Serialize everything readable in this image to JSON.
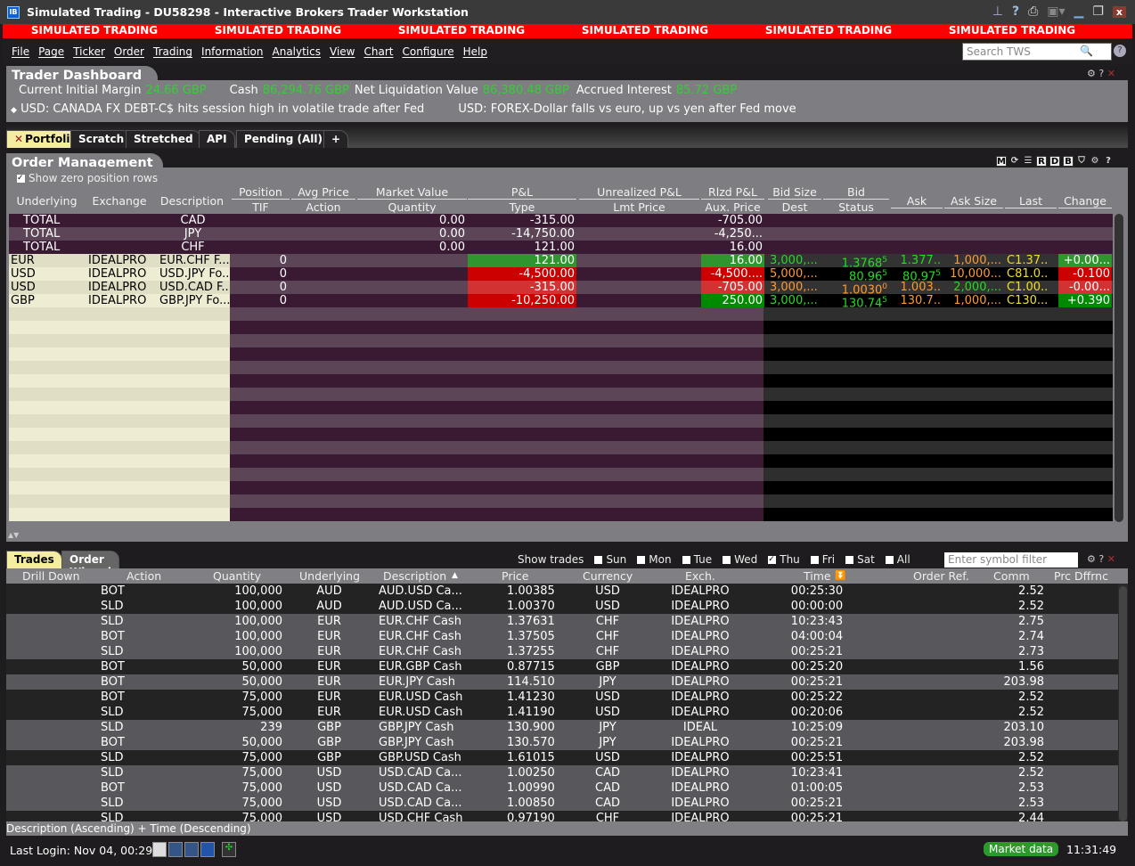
{
  "window": {
    "title": "Simulated Trading - DU58298 - Interactive Brokers Trader Workstation",
    "logo": "IB"
  },
  "banner": [
    "SIMULATED TRADING",
    "SIMULATED TRADING",
    "SIMULATED TRADING",
    "SIMULATED TRADING",
    "SIMULATED TRADING",
    "SIMULATED TRADING"
  ],
  "menu": [
    "File",
    "Page",
    "Ticker",
    "Order",
    "Trading",
    "Information",
    "Analytics",
    "View",
    "Chart",
    "Configure",
    "Help"
  ],
  "search": {
    "placeholder": "Search TWS"
  },
  "dashboard": {
    "title": "Trader Dashboard",
    "metrics": [
      {
        "label": "Current Initial Margin",
        "value": "24.66 GBP"
      },
      {
        "label": "Cash",
        "value": "86,294.76 GBP"
      },
      {
        "label": "Net Liquidation Value",
        "value": "86,380.48 GBP"
      },
      {
        "label": "Accrued Interest",
        "value": "85.72 GBP"
      }
    ],
    "news": [
      "USD: CANADA FX DEBT-C$ hits session high in volatile trade after Fed",
      "USD: FOREX-Dollar falls vs euro, up vs yen after Fed move"
    ]
  },
  "tabs": [
    "Portfolio",
    "Scratch",
    "Stretched",
    "API",
    "Pending (All)",
    "+"
  ],
  "order_mgmt": {
    "title": "Order Management",
    "show_zero": "Show zero position rows",
    "toolbar": [
      "M",
      "R",
      "D",
      "B"
    ],
    "headers_top": [
      "Underlying",
      "Exchange",
      "Description",
      "Position",
      "Avg Price",
      "Market Value",
      "P&L",
      "Unrealized P&L",
      "Rlzd P&L",
      "Bid Size",
      "Bid",
      "Ask",
      "Ask Size",
      "Last",
      "Change"
    ],
    "headers_bottom": [
      "TIF",
      "Action",
      "Quantity",
      "Type",
      "Lmt Price",
      "Aux. Price",
      "Dest",
      "Status"
    ],
    "totals": [
      {
        "label": "TOTAL",
        "currency": "CAD",
        "market_value": "0.00",
        "pnl": "-315.00",
        "rlzd": "-705.00"
      },
      {
        "label": "TOTAL",
        "currency": "JPY",
        "market_value": "0.00",
        "pnl": "-14,750.00",
        "rlzd": "-4,250..."
      },
      {
        "label": "TOTAL",
        "currency": "CHF",
        "market_value": "0.00",
        "pnl": "121.00",
        "rlzd": "16.00"
      }
    ],
    "positions": [
      {
        "underlying": "EUR",
        "exchange": "IDEALPRO",
        "description": "EUR.CHF F...",
        "position": "0",
        "pnl": "121.00",
        "pnl_bg": "#2f962f",
        "rlzd": "16.00",
        "rlzd_bg": "#2f962f",
        "bid_size": "3,000,...",
        "bid_size_c": "#22dd22",
        "bid": "1.3768",
        "bid_sup": "5",
        "bid_c": "#22dd22",
        "ask": "1.377..",
        "ask_c": "#22dd22",
        "ask_size": "1,000,...",
        "ask_size_c": "#ff9933",
        "last": "C1.37..",
        "change": "+0.00...",
        "change_bg": "#2f962f"
      },
      {
        "underlying": "USD",
        "exchange": "IDEALPRO",
        "description": "USD.JPY Fo...",
        "position": "0",
        "pnl": "-4,500.00",
        "pnl_bg": "#cc0000",
        "rlzd": "-4,500....",
        "rlzd_bg": "#cc0000",
        "bid_size": "5,000,...",
        "bid_size_c": "#ff9933",
        "bid": "80.96",
        "bid_sup": "5",
        "bid_c": "#22dd22",
        "ask": "80.97",
        "ask_sup": "5",
        "ask_c": "#22dd22",
        "ask_size": "10,000...",
        "ask_size_c": "#ff9933",
        "last": "C81.0..",
        "change": "-0.100",
        "change_bg": "#cc0000"
      },
      {
        "underlying": "USD",
        "exchange": "IDEALPRO",
        "description": "USD.CAD F...",
        "position": "0",
        "pnl": "-315.00",
        "pnl_bg": "#d23232",
        "rlzd": "-705.00",
        "rlzd_bg": "#d23232",
        "bid_size": "3,000,...",
        "bid_size_c": "#ff9933",
        "bid": "1.0030",
        "bid_sup": "0",
        "bid_c": "#ff9933",
        "ask": "1.003..",
        "ask_c": "#ff9933",
        "ask_size": "2,000,...",
        "ask_size_c": "#22dd22",
        "last": "C1.00..",
        "change": "-0.00...",
        "change_bg": "#d23232"
      },
      {
        "underlying": "GBP",
        "exchange": "IDEALPRO",
        "description": "GBP.JPY Fo...",
        "position": "0",
        "pnl": "-10,250.00",
        "pnl_bg": "#cc0000",
        "rlzd": "250.00",
        "rlzd_bg": "#008a00",
        "bid_size": "3,000,...",
        "bid_size_c": "#22dd22",
        "bid": "130.74",
        "bid_sup": "5",
        "bid_c": "#22dd22",
        "ask": "130.7..",
        "ask_c": "#ff9933",
        "ask_size": "1,000,...",
        "ask_size_c": "#ff9933",
        "last": "C130...",
        "change": "+0.390",
        "change_bg": "#008a00"
      }
    ]
  },
  "trades": {
    "tabs": [
      "Trades",
      "Order Wizard"
    ],
    "show_trades": "Show trades",
    "days": [
      {
        "d": "Sun",
        "on": false
      },
      {
        "d": "Mon",
        "on": false
      },
      {
        "d": "Tue",
        "on": false
      },
      {
        "d": "Wed",
        "on": false
      },
      {
        "d": "Thu",
        "on": true
      },
      {
        "d": "Fri",
        "on": false
      },
      {
        "d": "Sat",
        "on": false
      },
      {
        "d": "All",
        "on": false
      }
    ],
    "filter_placeholder": "Enter symbol filter",
    "headers": [
      "Drill Down",
      "Action",
      "Quantity",
      "Underlying",
      "Description",
      "Price",
      "Currency",
      "Exch.",
      "Time",
      "Order Ref.",
      "Comm",
      "Prc Dffrnc"
    ],
    "rows": [
      [
        "BOT",
        "100,000",
        "AUD",
        "AUD.USD Ca...",
        "1.00385",
        "USD",
        "IDEALPRO",
        "00:25:30",
        "2.52"
      ],
      [
        "SLD",
        "100,000",
        "AUD",
        "AUD.USD Ca...",
        "1.00370",
        "USD",
        "IDEALPRO",
        "00:00:00",
        "2.52"
      ],
      [
        "SLD",
        "100,000",
        "EUR",
        "EUR.CHF Cash",
        "1.37631",
        "CHF",
        "IDEALPRO",
        "10:23:43",
        "2.75"
      ],
      [
        "BOT",
        "100,000",
        "EUR",
        "EUR.CHF Cash",
        "1.37505",
        "CHF",
        "IDEALPRO",
        "04:00:04",
        "2.74"
      ],
      [
        "SLD",
        "100,000",
        "EUR",
        "EUR.CHF Cash",
        "1.37255",
        "CHF",
        "IDEALPRO",
        "00:25:21",
        "2.73"
      ],
      [
        "BOT",
        "50,000",
        "EUR",
        "EUR.GBP Cash",
        "0.87715",
        "GBP",
        "IDEALPRO",
        "00:25:20",
        "1.56"
      ],
      [
        "BOT",
        "50,000",
        "EUR",
        "EUR.JPY Cash",
        "114.510",
        "JPY",
        "IDEALPRO",
        "00:25:21",
        "203.98"
      ],
      [
        "BOT",
        "75,000",
        "EUR",
        "EUR.USD Cash",
        "1.41230",
        "USD",
        "IDEALPRO",
        "00:25:22",
        "2.52"
      ],
      [
        "SLD",
        "75,000",
        "EUR",
        "EUR.USD Cash",
        "1.41190",
        "USD",
        "IDEALPRO",
        "00:20:06",
        "2.52"
      ],
      [
        "SLD",
        "239",
        "GBP",
        "GBP.JPY Cash",
        "130.900",
        "JPY",
        "IDEAL",
        "10:25:09",
        "203.10"
      ],
      [
        "BOT",
        "50,000",
        "GBP",
        "GBP.JPY Cash",
        "130.570",
        "JPY",
        "IDEALPRO",
        "00:25:21",
        "203.98"
      ],
      [
        "SLD",
        "75,000",
        "GBP",
        "GBP.USD Cash",
        "1.61015",
        "USD",
        "IDEALPRO",
        "00:25:51",
        "2.52"
      ],
      [
        "SLD",
        "75,000",
        "USD",
        "USD.CAD Ca...",
        "1.00250",
        "CAD",
        "IDEALPRO",
        "10:23:41",
        "2.52"
      ],
      [
        "BOT",
        "75,000",
        "USD",
        "USD.CAD Ca...",
        "1.00990",
        "CAD",
        "IDEALPRO",
        "01:00:05",
        "2.53"
      ],
      [
        "SLD",
        "75,000",
        "USD",
        "USD.CAD Ca...",
        "1.00850",
        "CAD",
        "IDEALPRO",
        "00:25:21",
        "2.53"
      ],
      [
        "SLD",
        "75,000",
        "USD",
        "USD.CHF Cash",
        "0.97190",
        "CHF",
        "IDEALPRO",
        "00:25:21",
        "2.44"
      ]
    ],
    "sort_text": "Description (Ascending)  +  Time (Descending)"
  },
  "status": {
    "last_login": "Last Login: Nov 04, 00:29",
    "market_data": "Market data",
    "clock": "11:31:49"
  }
}
